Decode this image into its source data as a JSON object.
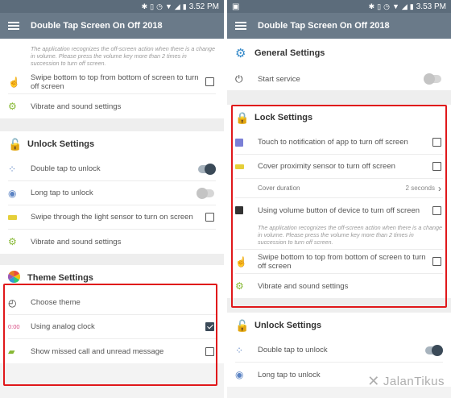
{
  "left": {
    "status": {
      "time": "3.52 PM"
    },
    "app_title": "Double Tap Screen On Off 2018",
    "top_description": "The application recognizes the off-screen action when there is a change in volume. Please press the volume key more than 2 times in succession to turn off screen.",
    "swipe_bottom_label": "Swipe bottom to top from bottom of screen to turn off screen",
    "vibrate_label_1": "Vibrate and sound settings",
    "unlock": {
      "title": "Unlock Settings",
      "double_tap": "Double tap to unlock",
      "long_tap": "Long tap to unlock",
      "light_sensor": "Swipe through the light sensor to turn on screen",
      "vibrate": "Vibrate and sound settings"
    },
    "theme": {
      "title": "Theme Settings",
      "choose": "Choose theme",
      "analog_clock": "Using analog clock",
      "clock_icon_text": "0:00",
      "missed_call": "Show missed call and unread message"
    }
  },
  "right": {
    "status": {
      "time": "3.53 PM"
    },
    "app_title": "Double Tap Screen On Off 2018",
    "general": {
      "title": "General Settings",
      "start_service": "Start service"
    },
    "lock": {
      "title": "Lock Settings",
      "touch_notification": "Touch to notification of app to turn off screen",
      "proximity": "Cover proximity sensor to turn off screen",
      "cover_duration_label": "Cover duration",
      "cover_duration_value": "2 seconds",
      "volume_button": "Using volume button of device to turn off screen",
      "volume_description": "The application recognizes the off-screen action when there is a change in volume. Please press the volume key more than 2 times in succession to turn off screen.",
      "swipe_bottom": "Swipe bottom to top from bottom of screen to turn off screen",
      "vibrate": "Vibrate and sound settings"
    },
    "unlock": {
      "title": "Unlock Settings",
      "double_tap": "Double tap to unlock",
      "long_tap": "Long tap to unlock"
    }
  },
  "watermark": "JalanTikus",
  "colors": {
    "appbar": "#6a7a89",
    "statusbar": "#5c6c7b",
    "highlight": "#e0181b",
    "accent": "#3b4a58"
  }
}
